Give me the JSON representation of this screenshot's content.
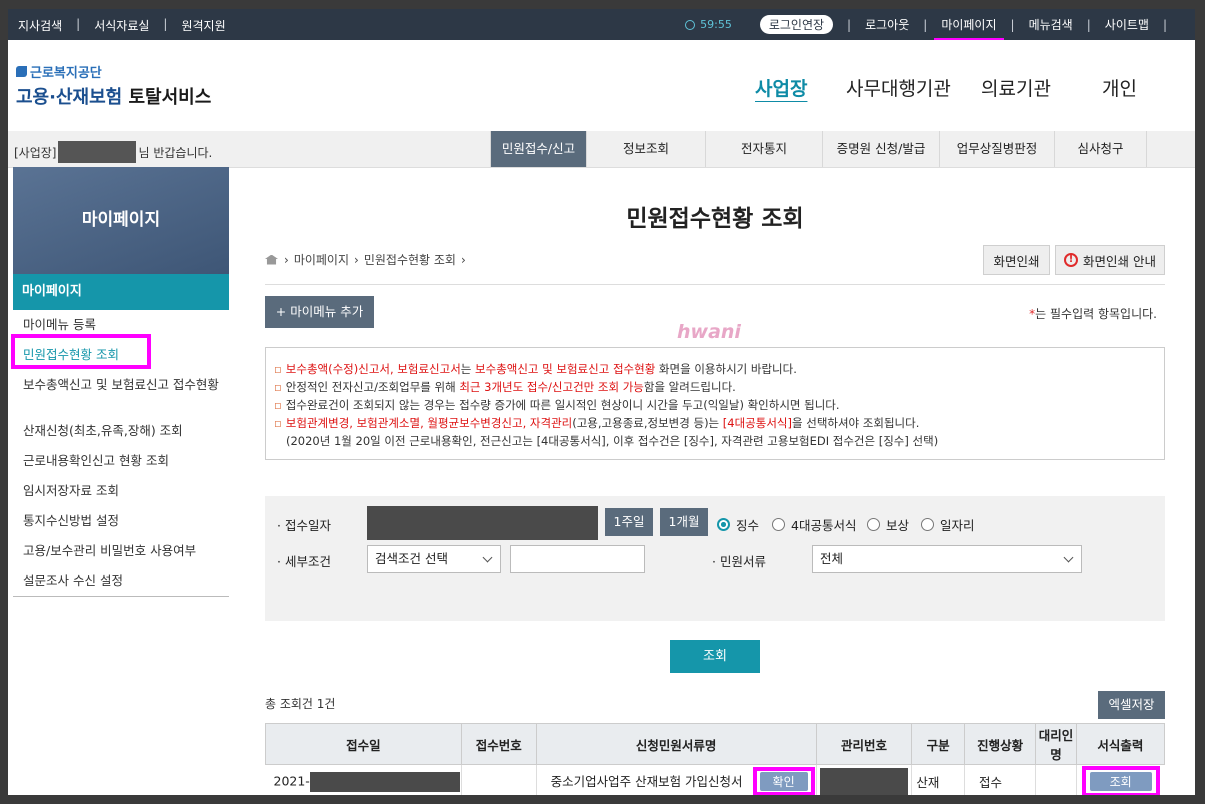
{
  "topbar": {
    "left_links": [
      "지사검색",
      "서식자료실",
      "원격지원"
    ],
    "timer": "59:55",
    "extend_login": "로그인연장",
    "right_links": [
      "로그아웃",
      "마이페이지",
      "메뉴검색",
      "사이트맵"
    ]
  },
  "logo": {
    "org": "근로복지공단",
    "title_a": "고용·산재보험",
    "title_b": "토탈서비스"
  },
  "gnb": [
    "사업장",
    "사무대행기관",
    "의료기관",
    "개인"
  ],
  "greeting": {
    "prefix": "[사업장]",
    "suffix": "님 반갑습니다."
  },
  "tabs": [
    "민원접수/신고",
    "정보조회",
    "전자통지",
    "증명원 신청/발급",
    "업무상질병판정",
    "심사청구"
  ],
  "lnb": {
    "banner": "마이페이지",
    "category": "마이페이지",
    "items": [
      "마이메뉴 등록",
      "민원접수현황 조회",
      "보수총액신고 및 보험료신고 접수현황",
      "산재신청(최초,유족,장해) 조회",
      "근로내용확인신고 현황 조회",
      "임시저장자료 조회",
      "통지수신방법 설정",
      "고용/보수관리 비밀번호 사용여부",
      "설문조사 수신 설정"
    ]
  },
  "main": {
    "title": "민원접수현황 조회",
    "breadcrumb": [
      "마이페이지",
      "민원접수현황 조회"
    ],
    "print_button": "화면인쇄",
    "print_guide_button": "화면인쇄 안내",
    "add_menu_button": "+ 마이메뉴 추가",
    "required_mark": "*",
    "required_note": "는 필수입력 항목입니다.",
    "watermark": "hwani"
  },
  "notice": {
    "l1_red1": "보수총액(수정)신고서, 보험료신고서",
    "l1_t1": "는 ",
    "l1_red2": "보수총액신고 및 보험료신고 접수현황",
    "l1_t2": " 화면을 이용하시기 바랍니다.",
    "l2_t1": "안정적인 전자신고/조회업무를 위해 ",
    "l2_red": "최근 3개년도 접수/신고건만 조회 가능",
    "l2_t2": "함을 알려드립니다.",
    "l3": "접수완료건이 조회되지 않는 경우는 접수량 증가에 따른 일시적인 현상이니 시간을 두고(익일날) 확인하시면 됩니다.",
    "l4_red1": "보험관계변경, 보험관계소멸, 월평균보수변경신고, 자격관리",
    "l4_t1": "(고용,고용종료,정보변경 등)는 ",
    "l4_red2": "[4대공통서식]",
    "l4_t2": "을 선택하셔야 조회됩니다.",
    "l5": "(2020년 1월 20일 이전 근로내용확인, 전근신고는 [4대공통서식], 이후 접수건은 [징수], 자격관련 고용보험EDI 접수건은 [징수] 선택)"
  },
  "search": {
    "date_label": "· 접수일자",
    "week_button": "1주일",
    "month_button": "1개월",
    "radios": [
      "징수",
      "4대공통서식",
      "보상",
      "일자리"
    ],
    "selected_radio": "징수",
    "detail_label": "· 세부조건",
    "detail_select": "검색조건 선택",
    "doc_label": "· 민원서류",
    "doc_select": "전체",
    "submit": "조회"
  },
  "results": {
    "total": "총 조회건 1건",
    "excel_button": "엑셀저장",
    "columns": [
      "접수일",
      "접수번호",
      "신청민원서류명",
      "관리번호",
      "구분",
      "진행상황",
      "대리인명",
      "서식출력"
    ],
    "row": {
      "date_prefix": "2021-",
      "doc_name": "중소기업사업주 산재보험 가입신청서",
      "confirm_button": "확인",
      "type": "산재",
      "status": "접수",
      "view_button": "조회"
    }
  },
  "colors": {
    "topbar": "#2d3846",
    "accent": "#1596aa",
    "tab_active": "#5a6b7c",
    "highlight": "#ff00ff"
  }
}
